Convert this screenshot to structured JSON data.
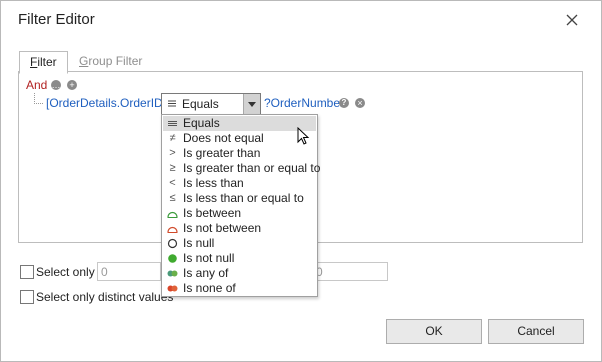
{
  "window": {
    "title": "Filter Editor",
    "close_icon": "close-icon"
  },
  "tabs": [
    {
      "label_first": "F",
      "label_rest": "ilter",
      "active": true
    },
    {
      "label_first": "G",
      "label_rest": "roup Filter",
      "active": false
    }
  ],
  "filter": {
    "group_operator": "And",
    "condition": {
      "field": "[OrderDetails.OrderID]",
      "operator": "Equals",
      "value": "?OrderNumber"
    }
  },
  "operator_options": [
    {
      "label": "Equals",
      "icon": "equals-icon",
      "selected": true
    },
    {
      "label": "Does not equal",
      "icon": "not-equal-icon",
      "selected": false
    },
    {
      "label": "Is greater than",
      "icon": "greater-than-icon",
      "selected": false
    },
    {
      "label": "Is greater than or equal to",
      "icon": "greater-or-equal-icon",
      "selected": false
    },
    {
      "label": "Is less than",
      "icon": "less-than-icon",
      "selected": false
    },
    {
      "label": "Is less than or equal to",
      "icon": "less-or-equal-icon",
      "selected": false
    },
    {
      "label": "Is between",
      "icon": "between-icon",
      "selected": false
    },
    {
      "label": "Is not between",
      "icon": "not-between-icon",
      "selected": false
    },
    {
      "label": "Is null",
      "icon": "null-icon",
      "selected": false
    },
    {
      "label": "Is not null",
      "icon": "not-null-icon",
      "selected": false
    },
    {
      "label": "Is any of",
      "icon": "any-of-icon",
      "selected": false
    },
    {
      "label": "Is none of",
      "icon": "none-of-icon",
      "selected": false
    }
  ],
  "select_only": {
    "label": "Select only",
    "from_value": "0",
    "to_value": "0",
    "checked": false
  },
  "select_distinct": {
    "label": "Select only distinct values",
    "checked": false
  },
  "buttons": {
    "ok": "OK",
    "cancel": "Cancel"
  },
  "colors": {
    "operator_red": "#b22222",
    "field_blue": "#1f5fbf",
    "selected_row": "#dcdcdc"
  }
}
